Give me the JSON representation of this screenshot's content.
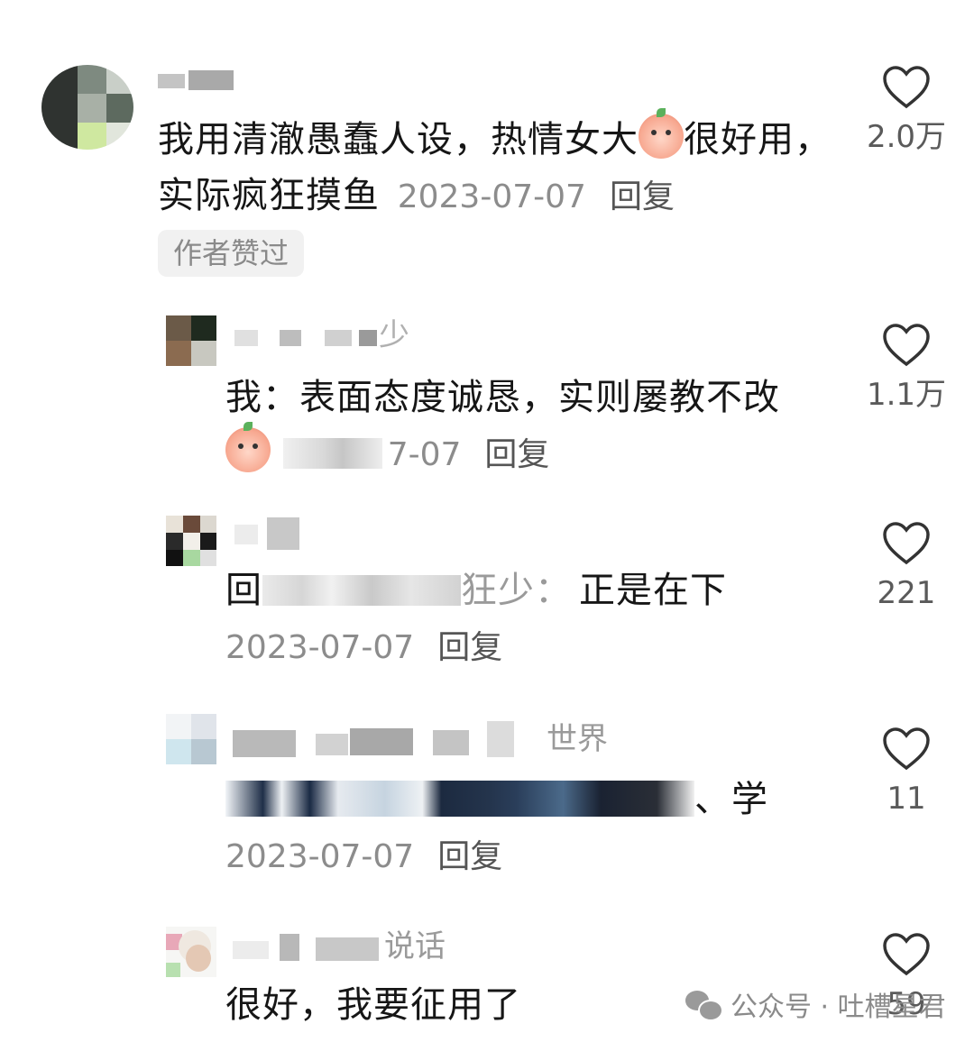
{
  "comments": [
    {
      "text_before_emoji": "我用清澈愚蠢人设，热情女大",
      "text_after_emoji": "很好用，实际疯狂摸鱼",
      "date": "2023-07-07",
      "reply_label": "回复",
      "author_badge": "作者赞过",
      "likes": "2.0万"
    },
    {
      "username_visible": "少",
      "text": "我：表面态度诚恳，实则屡教不改",
      "date_visible": "7-07",
      "reply_label": "回复",
      "likes": "1.1万"
    },
    {
      "text_prefix": "回",
      "text_mid": "狂少：",
      "text_suffix": "正是在下",
      "date": "2023-07-07",
      "reply_label": "回复",
      "likes": "221"
    },
    {
      "username_visible": "世界",
      "text_suffix": "、学",
      "date": "2023-07-07",
      "reply_label": "回复",
      "likes": "11"
    },
    {
      "username_visible": "说话",
      "text": "很好，我要征用了",
      "likes": "59"
    }
  ],
  "watermark": {
    "text": "公众号 · 吐槽星君",
    "icon": "wechat-icon"
  },
  "colors": {
    "text": "#161616",
    "meta": "#8c8c8c",
    "badge_bg": "#f1f1f1"
  }
}
